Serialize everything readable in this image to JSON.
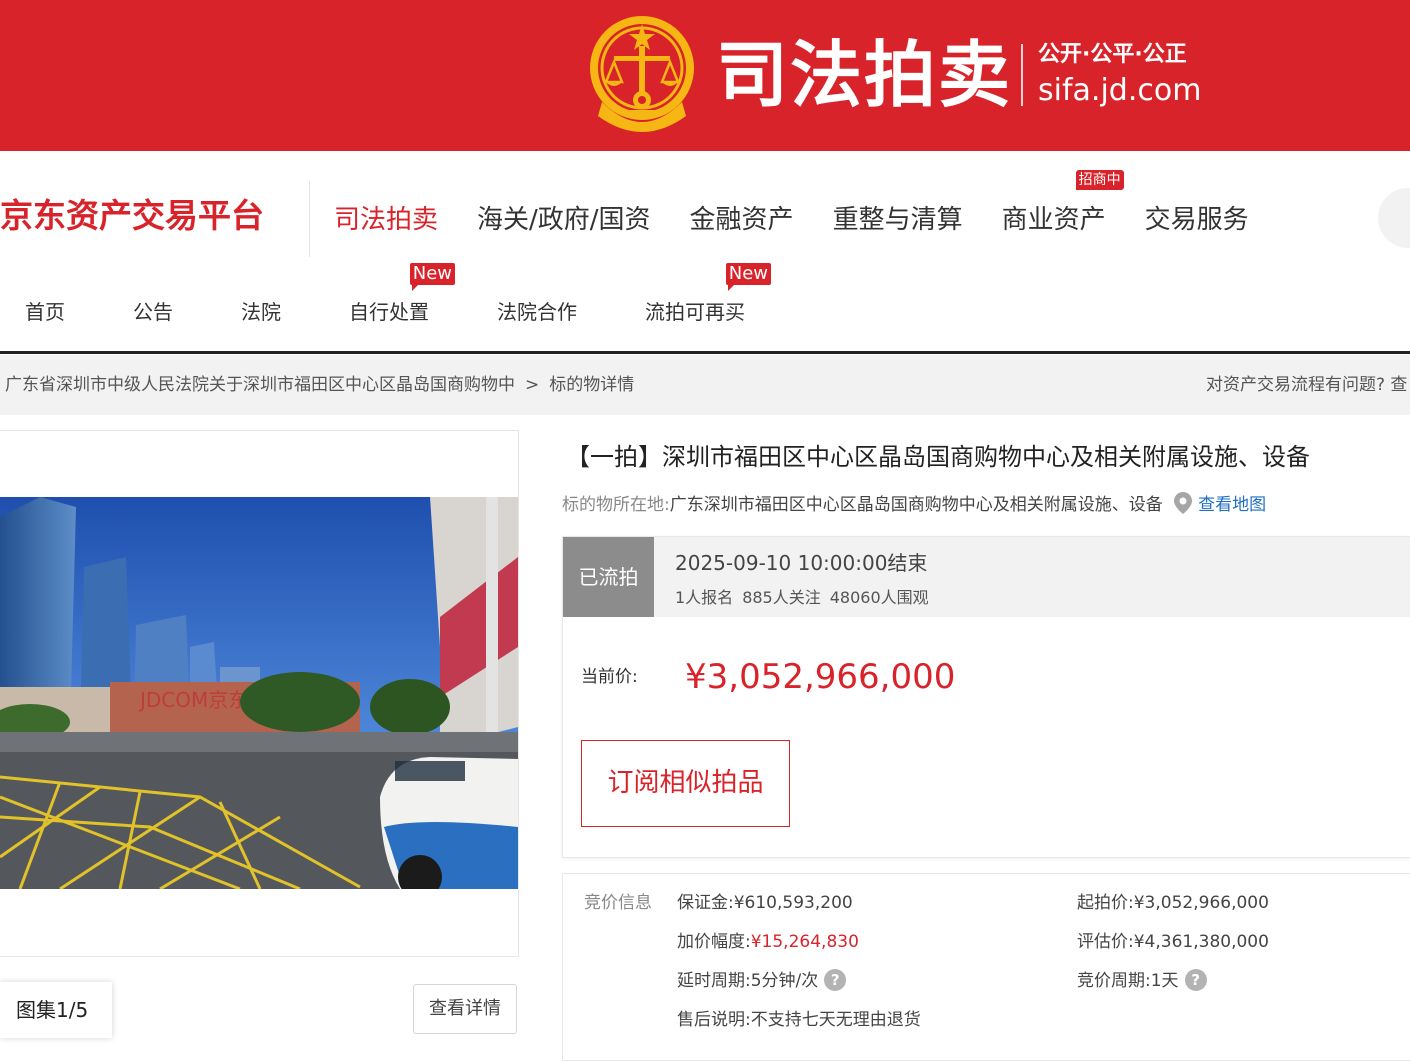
{
  "banner": {
    "title": "司法拍卖",
    "slogan": "公开·公平·公正",
    "domain": "sifa.jd.com",
    "color": "#d9232a"
  },
  "platform": {
    "logo": "京东资产交易平台",
    "nav": [
      {
        "label": "司法拍卖",
        "active": true
      },
      {
        "label": "海关/政府/国资"
      },
      {
        "label": "金融资产"
      },
      {
        "label": "重整与清算"
      },
      {
        "label": "商业资产",
        "badge": "招商中"
      },
      {
        "label": "交易服务"
      }
    ]
  },
  "subnav": {
    "items": [
      {
        "label": "首页"
      },
      {
        "label": "公告"
      },
      {
        "label": "法院"
      },
      {
        "label": "自行处置",
        "badge": "New"
      },
      {
        "label": "法院合作"
      },
      {
        "label": "流拍可再买",
        "badge": "New"
      }
    ]
  },
  "breadcrumb": {
    "parent": "广东省深圳市中级人民法院关于深圳市福田区中心区晶岛国商购物中",
    "separator": ">",
    "current": "标的物详情",
    "help": "对资产交易流程有问题? 查"
  },
  "gallery": {
    "counter": "图集1/5",
    "detail_button": "查看详情",
    "watermark": "JDCOM京东"
  },
  "lot": {
    "title": "【一拍】深圳市福田区中心区晶岛国商购物中心及相关附属设施、设备",
    "location_label": "标的物所在地:",
    "location": "广东深圳市福田区中心区晶岛国商购物中心及相关附属设施、设备",
    "map_link": "查看地图",
    "status": "已流拍",
    "end_time": "2025-09-10 10:00:00结束",
    "stats": [
      "1人报名",
      "885人关注",
      "48060人围观"
    ],
    "price_label": "当前价:",
    "price": "¥3,052,966,000",
    "subscribe": "订阅相似拍品"
  },
  "bid_info": {
    "label": "竞价信息",
    "deposit_label": "保证金:",
    "deposit": "¥610,593,200",
    "starting_label": "起拍价:",
    "starting": "¥3,052,966,000",
    "increment_label": "加价幅度:",
    "increment": "¥15,264,830",
    "appraisal_label": "评估价:",
    "appraisal": "¥4,361,380,000",
    "delay_label": "延时周期:",
    "delay": "5分钟/次",
    "period_label": "竞价周期:",
    "period": "1天",
    "aftersale_label": "售后说明:",
    "aftersale": "不支持七天无理由退货"
  }
}
